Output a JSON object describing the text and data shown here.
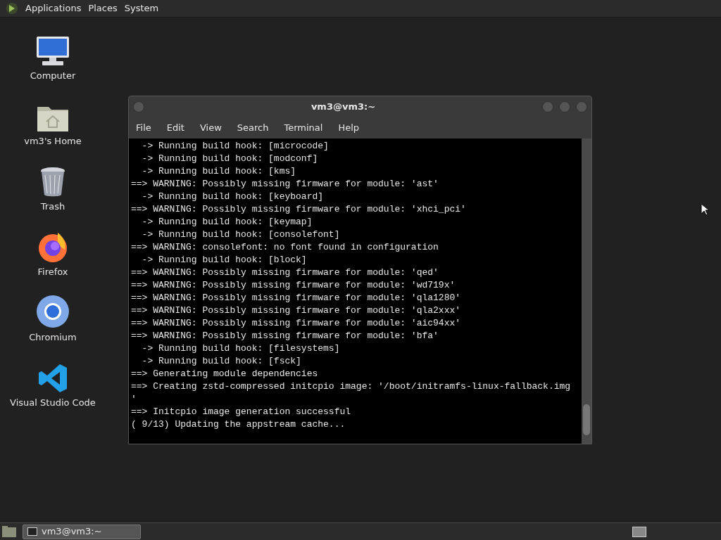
{
  "top_panel": {
    "menus": [
      "Applications",
      "Places",
      "System"
    ]
  },
  "desktop_icons": [
    {
      "kind": "computer",
      "label": "Computer"
    },
    {
      "kind": "home",
      "label": "vm3's Home"
    },
    {
      "kind": "trash",
      "label": "Trash"
    },
    {
      "kind": "firefox",
      "label": "Firefox"
    },
    {
      "kind": "chromium",
      "label": "Chromium"
    },
    {
      "kind": "vscode",
      "label": "Visual Studio Code"
    }
  ],
  "window": {
    "title": "vm3@vm3:~",
    "menu": [
      "File",
      "Edit",
      "View",
      "Search",
      "Terminal",
      "Help"
    ],
    "lines": [
      "  -> Running build hook: [microcode]",
      "  -> Running build hook: [modconf]",
      "  -> Running build hook: [kms]",
      "==> WARNING: Possibly missing firmware for module: 'ast'",
      "  -> Running build hook: [keyboard]",
      "==> WARNING: Possibly missing firmware for module: 'xhci_pci'",
      "  -> Running build hook: [keymap]",
      "  -> Running build hook: [consolefont]",
      "==> WARNING: consolefont: no font found in configuration",
      "  -> Running build hook: [block]",
      "==> WARNING: Possibly missing firmware for module: 'qed'",
      "==> WARNING: Possibly missing firmware for module: 'wd719x'",
      "==> WARNING: Possibly missing firmware for module: 'qla1280'",
      "==> WARNING: Possibly missing firmware for module: 'qla2xxx'",
      "==> WARNING: Possibly missing firmware for module: 'aic94xx'",
      "==> WARNING: Possibly missing firmware for module: 'bfa'",
      "  -> Running build hook: [filesystems]",
      "  -> Running build hook: [fsck]",
      "==> Generating module dependencies",
      "==> Creating zstd-compressed initcpio image: '/boot/initramfs-linux-fallback.img",
      "'",
      "==> Initcpio image generation successful",
      "( 9/13) Updating the appstream cache..."
    ]
  },
  "taskbar": {
    "tasks": [
      {
        "label": "vm3@vm3:~",
        "selected": true
      }
    ]
  }
}
